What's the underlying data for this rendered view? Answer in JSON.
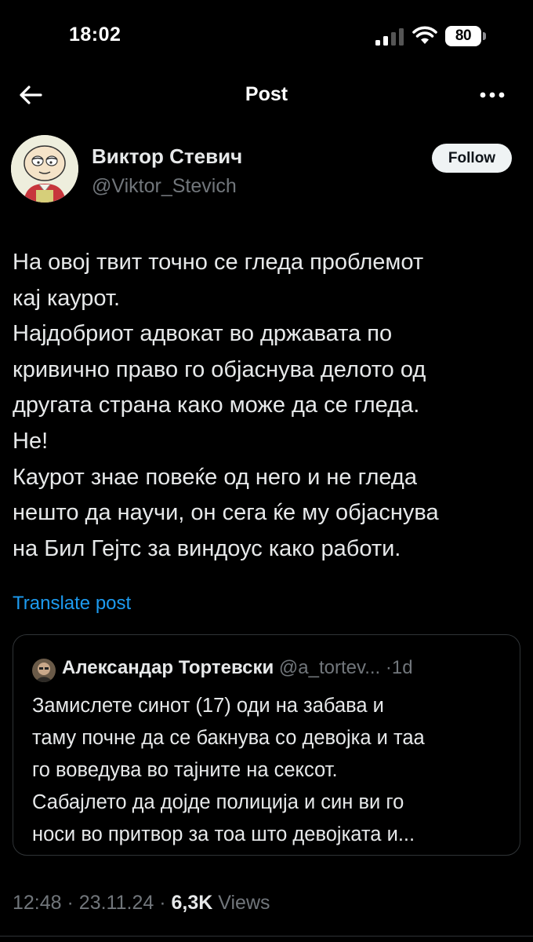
{
  "status_bar": {
    "time": "18:02",
    "battery": "80",
    "icons": [
      "signal-icon",
      "wifi-icon",
      "battery-icon"
    ]
  },
  "header": {
    "title": "Post",
    "icons": [
      "back-arrow-icon",
      "more-options-icon"
    ]
  },
  "author": {
    "name": "Виктор Стевич",
    "handle": "@Viktor_Stevich",
    "follow_label": "Follow"
  },
  "tweet": {
    "lines": [
      "На овој твит точно се гледа проблемот",
      "кај каурот.",
      "Најдобриот адвокат во државата по",
      "кривично право го објаснува делото од",
      "другата страна како може да се гледа.",
      "Не!",
      "Каурот знае повеќе од него и не гледа",
      "нешто да научи, он сега ќе му објаснува",
      "на Бил Гејтс за виндоус како работи."
    ],
    "translate_label": "Translate post"
  },
  "quote": {
    "name": "Александар Тортевски",
    "handle": "@a_tortev...",
    "separator": "·",
    "time": "1d",
    "lines": [
      "Замислете синот (17) оди на забава и",
      "таму почне да се бакнува со девојка и таа",
      "го воведува во тајните на сексот.",
      "Сабајлето да дојде полиција и син ви го",
      "носи во притвор за тоа што девојката и..."
    ]
  },
  "meta": {
    "time": "12:48",
    "separator": "·",
    "date": "23.11.24",
    "views_count": "6,3K",
    "views_label": "Views"
  },
  "colors": {
    "background": "#000000",
    "text": "#e7e9ea",
    "secondary": "#71767b",
    "link": "#1d9bf0",
    "border": "#2f3336"
  }
}
